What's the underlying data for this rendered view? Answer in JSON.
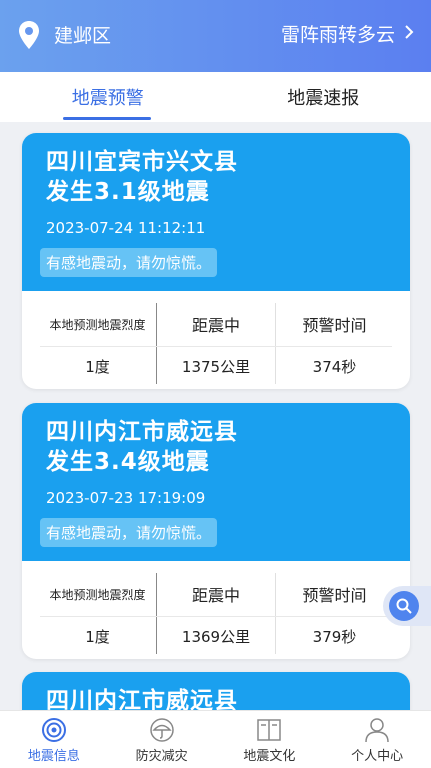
{
  "header": {
    "location": "建邺区",
    "weather": "雷阵雨转多云",
    "icons": {
      "location": "location-pin-icon",
      "chevron": "chevron-right-icon"
    }
  },
  "tabs": [
    {
      "label": "地震预警",
      "active": true
    },
    {
      "label": "地震速报",
      "active": false
    }
  ],
  "cards": [
    {
      "title_line1": "四川宜宾市兴文县",
      "title_line2": "发生3.1级地震",
      "time": "2023-07-24 11:12:11",
      "note": "有感地震动，请勿惊慌。",
      "headers": [
        "本地预测地震烈度",
        "距震中",
        "预警时间"
      ],
      "values": [
        "1度",
        "1375公里",
        "374秒"
      ]
    },
    {
      "title_line1": "四川内江市威远县",
      "title_line2": "发生3.4级地震",
      "time": "2023-07-23 17:19:09",
      "note": "有感地震动，请勿惊慌。",
      "headers": [
        "本地预测地震烈度",
        "距震中",
        "预警时间"
      ],
      "values": [
        "1度",
        "1369公里",
        "379秒"
      ]
    },
    {
      "title_line1": "四川内江市威远县"
    }
  ],
  "nav": [
    {
      "label": "地震信息",
      "icon": "seismic-wave-icon",
      "active": true
    },
    {
      "label": "防灾减灾",
      "icon": "umbrella-icon",
      "active": false
    },
    {
      "label": "地震文化",
      "icon": "book-icon",
      "active": false
    },
    {
      "label": "个人中心",
      "icon": "person-icon",
      "active": false
    }
  ],
  "colors": {
    "header_start": "#6ba1ee",
    "header_end": "#5b7ff0",
    "card_blue": "#1aa0ef",
    "accent": "#3b6fe4"
  }
}
